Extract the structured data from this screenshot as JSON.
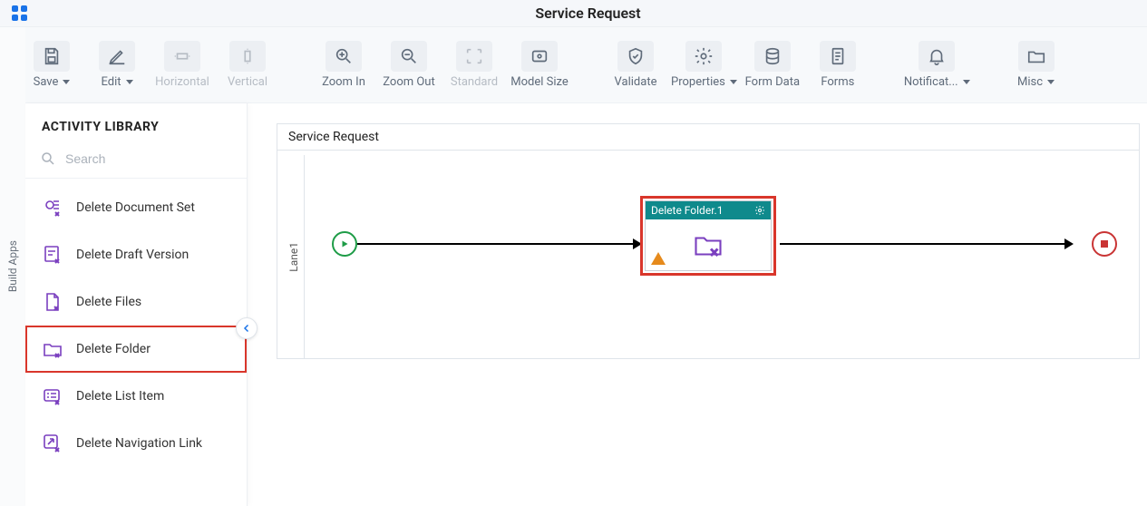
{
  "header": {
    "title": "Service Request"
  },
  "left_rail": {
    "label": "Build Apps"
  },
  "toolbar": {
    "save": "Save",
    "edit": "Edit",
    "horizontal": "Horizontal",
    "vertical": "Vertical",
    "zoom_in": "Zoom In",
    "zoom_out": "Zoom Out",
    "standard": "Standard",
    "model_size": "Model Size",
    "validate": "Validate",
    "properties": "Properties",
    "form_data": "Form Data",
    "forms": "Forms",
    "notifications": "Notificat...",
    "misc": "Misc"
  },
  "sidebar": {
    "heading": "ACTIVITY LIBRARY",
    "search_placeholder": "Search",
    "items": [
      {
        "label": "Delete Document Set"
      },
      {
        "label": "Delete Draft Version"
      },
      {
        "label": "Delete Files"
      },
      {
        "label": "Delete Folder"
      },
      {
        "label": "Delete List Item"
      },
      {
        "label": "Delete Navigation Link"
      }
    ],
    "selected_index": 3
  },
  "canvas": {
    "title": "Service Request",
    "lane": "Lane1",
    "activity": {
      "title": "Delete Folder.1"
    }
  },
  "colors": {
    "accent_red": "#d9362b",
    "teal": "#0f8a8c",
    "green": "#1e9c47",
    "purple": "#7a3fbf",
    "blue": "#1a73e8"
  }
}
